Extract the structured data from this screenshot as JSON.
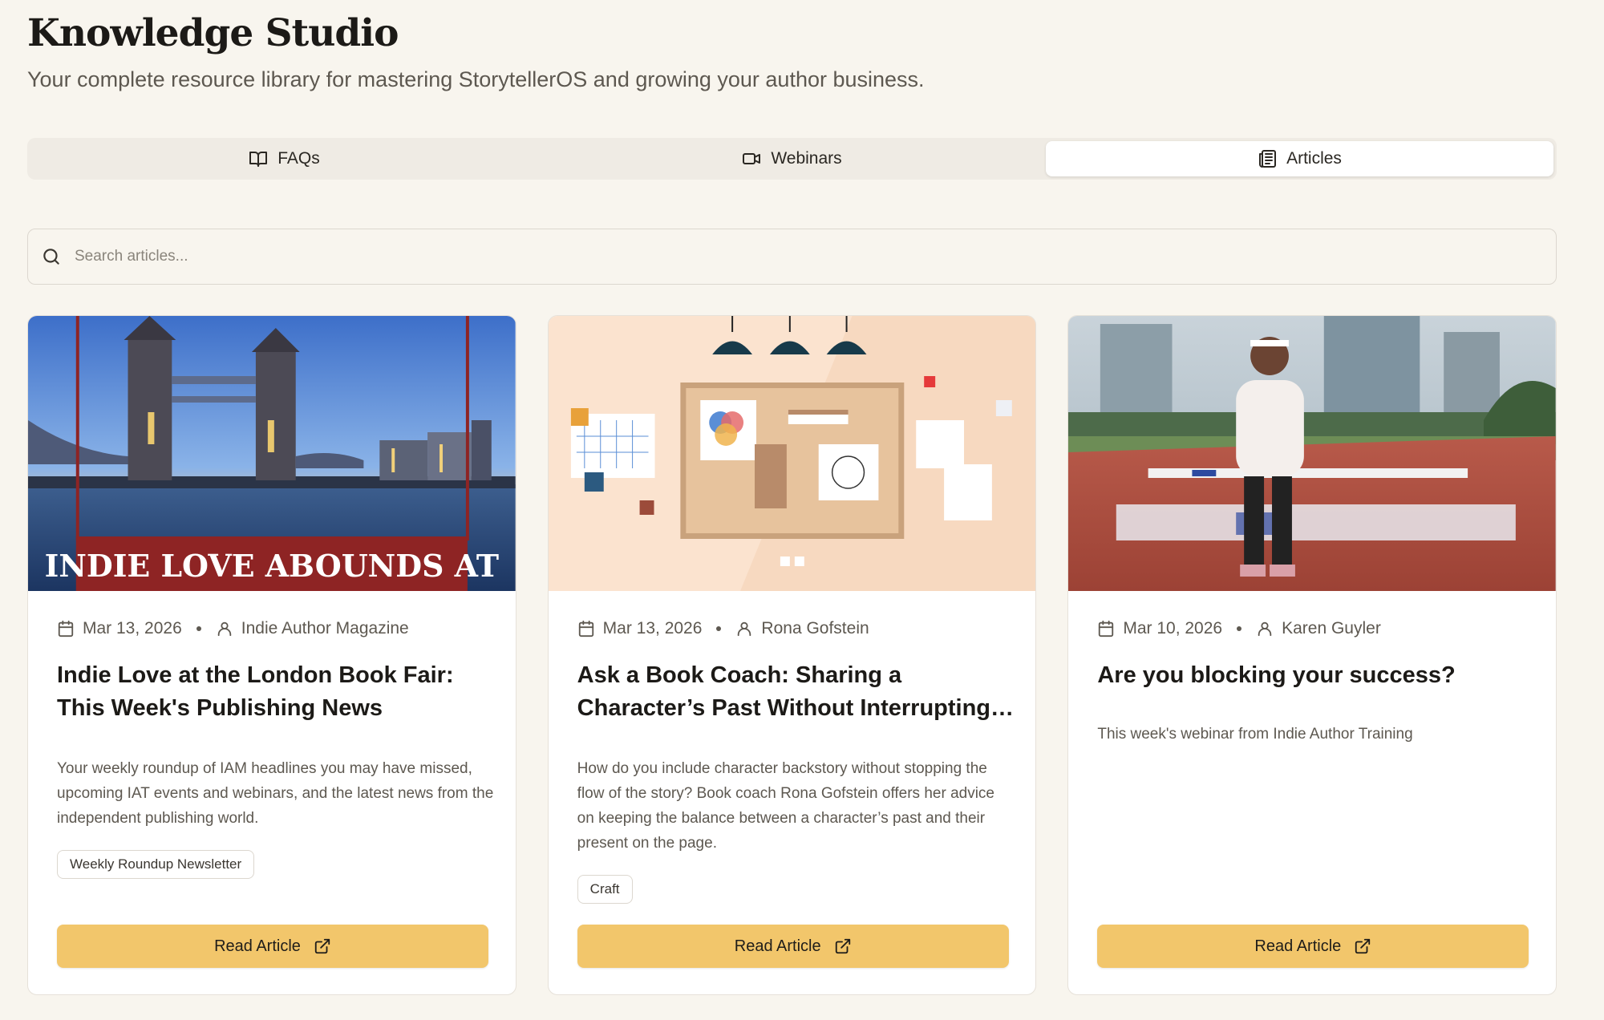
{
  "header": {
    "title": "Knowledge Studio",
    "subtitle": "Your complete resource library for mastering StorytellerOS and growing your author business."
  },
  "tabs": [
    {
      "label": "FAQs",
      "icon": "book-open-icon",
      "active": false
    },
    {
      "label": "Webinars",
      "icon": "video-camera-icon",
      "active": false
    },
    {
      "label": "Articles",
      "icon": "newspaper-icon",
      "active": true
    }
  ],
  "search": {
    "placeholder": "Search articles...",
    "value": ""
  },
  "articles": [
    {
      "image": "london-tower-bridge-banner",
      "banner_text": "INDIE LOVE ABOUNDS AT",
      "date": "Mar 13, 2026",
      "author": "Indie Author Magazine",
      "title": "Indie Love at the London Book Fair: This Week's Publishing News",
      "description": "Your weekly roundup of IAM headlines you may have missed, upcoming IAT events and webinars, and the latest news from the independent publishing world.",
      "tag": "Weekly Roundup Newsletter",
      "button": "Read Article"
    },
    {
      "image": "corkboard-illustration",
      "date": "Mar 13, 2026",
      "author": "Rona Gofstein",
      "title": "Ask a Book Coach: Sharing a Character’s Past Without Interrupting…",
      "description": "How do you include character backstory without stopping the flow of the story? Book coach Rona Gofstein offers her advice on keeping the balance between a character’s past and their present on the page.",
      "tag": "Craft",
      "button": "Read Article"
    },
    {
      "image": "hurdle-runner-photo",
      "date": "Mar 10, 2026",
      "author": "Karen Guyler",
      "title": "Are you blocking your success?",
      "description": "This week's webinar from Indie Author Training",
      "tag": "",
      "button": "Read Article"
    }
  ],
  "colors": {
    "background": "#f8f5ee",
    "button": "#f2c66b",
    "banner_red": "#8e2424"
  }
}
